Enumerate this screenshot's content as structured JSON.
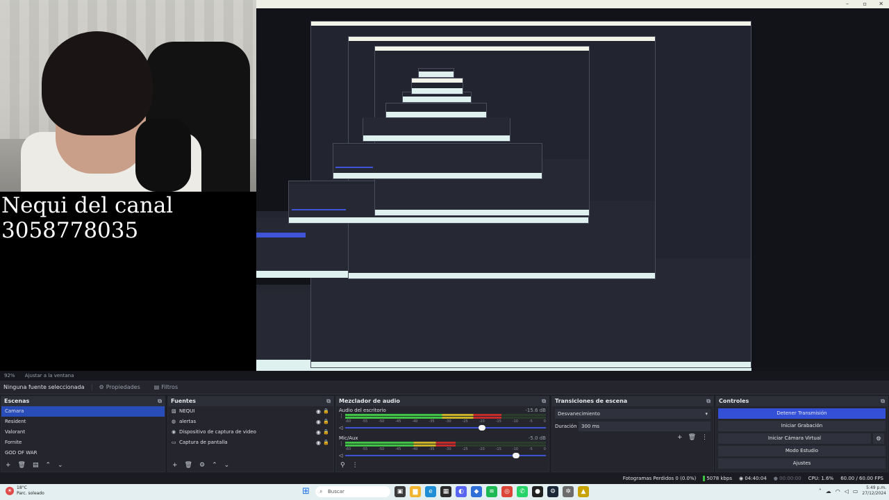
{
  "overlay": {
    "line1": "Nequi del canal",
    "line2": "3058778035"
  },
  "preview_strip": {
    "zoom": "92%",
    "fit": "Ajustar a la ventana"
  },
  "source_toolbar": {
    "no_source": "Ninguna fuente seleccionada",
    "properties": "Propiedades",
    "filters": "Filtros"
  },
  "scenes": {
    "title": "Escenas",
    "items": [
      "Camara",
      "Resident",
      "Valorant",
      "Fornite",
      "GOD OF WAR"
    ],
    "selected": "Camara"
  },
  "sources": {
    "title": "Fuentes",
    "items": [
      {
        "label": "NEQUI",
        "icon": "image-icon"
      },
      {
        "label": "alertas",
        "icon": "browser-icon"
      },
      {
        "label": "Dispositivo de captura de video",
        "icon": "camera-icon"
      },
      {
        "label": "Captura de pantalla",
        "icon": "monitor-icon"
      }
    ]
  },
  "mixer": {
    "title": "Mezclador de audio",
    "scale": [
      "-60",
      "-55",
      "-50",
      "-45",
      "-40",
      "-35",
      "-30",
      "-25",
      "-20",
      "-15",
      "-10",
      "-5",
      "0"
    ],
    "channels": [
      {
        "name": "Audio del escritorio",
        "db": "-15.6 dB",
        "level": 0.78,
        "volume": 0.68
      },
      {
        "name": "Mic/Aux",
        "db": "-5.0 dB",
        "level": 0.55,
        "volume": 0.85
      }
    ]
  },
  "transitions": {
    "title": "Transiciones de escena",
    "type": "Desvanecimiento",
    "duration_label": "Duración",
    "duration_value": "300 ms"
  },
  "controls": {
    "title": "Controles",
    "stop_stream": "Detener Transmisión",
    "start_recording": "Iniciar Grabación",
    "virtual_cam": "Iniciar Cámara Virtual",
    "studio_mode": "Modo Estudio",
    "settings": "Ajustes"
  },
  "status": {
    "dropped": "Fotogramas Perdidos 0 (0.0%)",
    "kbps": "5078 kbps",
    "stream_time": "04:40:04",
    "rec_time": "00:00:00",
    "cpu": "CPU: 1.6%",
    "fps": "60.00 / 60.00 FPS"
  },
  "taskbar": {
    "temp": "18°C",
    "weather": "Parc. soleado",
    "search": "Buscar",
    "time": "5:49 p.m.",
    "date": "27/12/2024"
  },
  "colors": {
    "accent": "#3450d6",
    "selected": "#284cb8",
    "panel": "#24252d"
  }
}
